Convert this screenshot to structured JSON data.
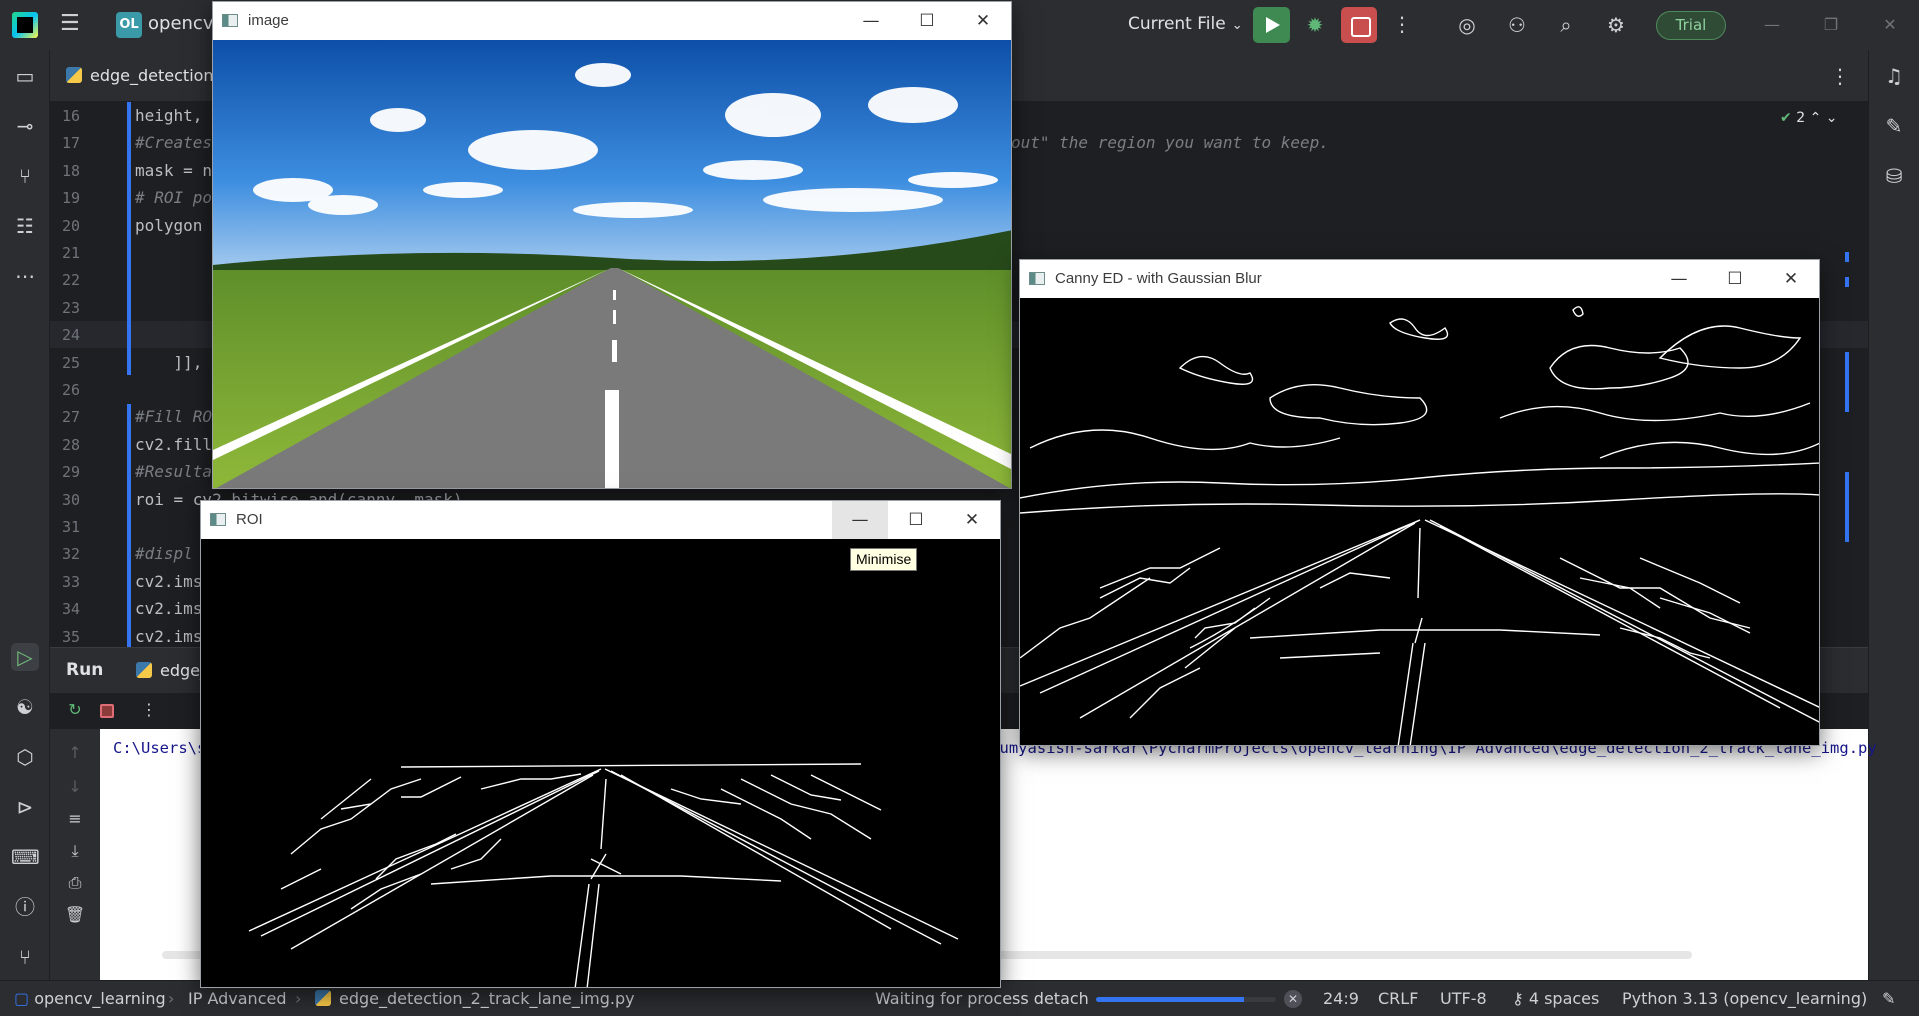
{
  "titlebar": {
    "project_badge": "OL",
    "project_name": "opencv_learning",
    "run_config": "Current File",
    "trial_label": "Trial",
    "icons": [
      "hamburger-icon",
      "run-icon",
      "debug-icon",
      "stop-icon",
      "more-icon",
      "ai-assistant-icon",
      "add-user-icon",
      "search-icon",
      "settings-icon"
    ]
  },
  "editor": {
    "tab_label": "edge_detection_2_track_lane_img.py",
    "inspection_count": "2",
    "lines": [
      {
        "n": "16",
        "text": "height, ",
        "comment": false
      },
      {
        "n": "17",
        "text": "#Creates",
        "comment": true
      },
      {
        "n": "18",
        "text": "mask = n",
        "comment": false
      },
      {
        "n": "19",
        "text": "# ROI po",
        "comment": true
      },
      {
        "n": "20",
        "text": "polygon ",
        "comment": false
      },
      {
        "n": "21",
        "text": "",
        "comment": false
      },
      {
        "n": "22",
        "text": "",
        "comment": false
      },
      {
        "n": "23",
        "text": "",
        "comment": false
      },
      {
        "n": "24",
        "text": "",
        "comment": false
      },
      {
        "n": "25",
        "text": "    ]],",
        "comment": false
      },
      {
        "n": "26",
        "text": "",
        "comment": false
      },
      {
        "n": "27",
        "text": "#Fill RO",
        "comment": true
      },
      {
        "n": "28",
        "text": "cv2.fill",
        "comment": false
      },
      {
        "n": "29",
        "text": "#Resulta",
        "comment": true
      },
      {
        "n": "30",
        "text": "roi = cv2.bitwise_and(canny, mask)",
        "comment": false
      },
      {
        "n": "31",
        "text": "",
        "comment": false
      },
      {
        "n": "32",
        "text": "#displ",
        "comment": true
      },
      {
        "n": "33",
        "text": "cv2.ims",
        "comment": false
      },
      {
        "n": "34",
        "text": "cv2.ims",
        "comment": false
      },
      {
        "n": "35",
        "text": "cv2.ims",
        "comment": false
      }
    ],
    "comment_tail": "out\" the region you want to keep."
  },
  "run": {
    "title": "Run",
    "tab_label": "edge_detection_2_track_lane_img",
    "console_line": "C:\\Users\\soumyasish-sarkar\\PycharmProjects\\opencv_learning\\.venv\\Scripts\\python.exe C:\\Users\\soumyasish-sarkar\\PycharmProjects\\opencv_learning\\IP Advanced\\edge_detection_2_track_lane_img.py"
  },
  "statusbar": {
    "breadcrumb": [
      "opencv_learning",
      "IP Advanced",
      "edge_detection_2_track_lane_img.py"
    ],
    "process_text": "Waiting for process detach",
    "progress": 0.82,
    "position": "24:9",
    "line_sep": "CRLF",
    "encoding": "UTF-8",
    "indent": "4 spaces",
    "interpreter": "Python 3.13 (opencv_learning)"
  },
  "windows": {
    "image": {
      "title": "image"
    },
    "canny": {
      "title": "Canny ED - with Gaussian Blur"
    },
    "roi": {
      "title": "ROI",
      "tooltip": "Minimise"
    }
  },
  "colors": {
    "accent": "#3574f0",
    "run_green": "#3e8a52",
    "stop_red": "#c94f4f",
    "sky": "#1d6fc4",
    "grass": "#6aa82c",
    "road": "#6e6e6e"
  }
}
